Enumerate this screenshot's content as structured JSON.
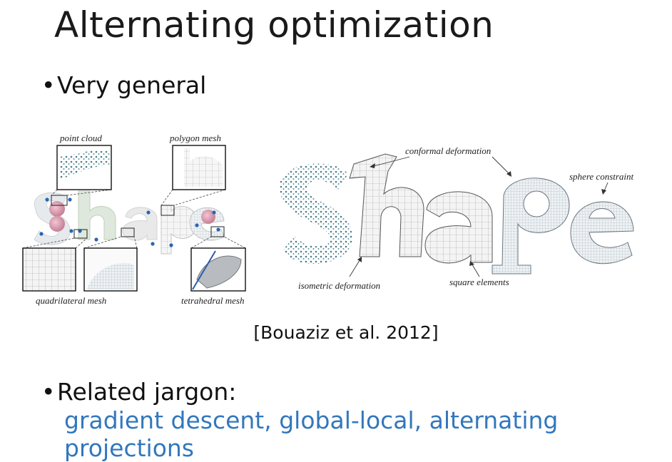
{
  "slide": {
    "title": "Alternating optimization",
    "bullet1": "Very general",
    "citation": "[Bouaziz et al. 2012]",
    "bullet2": "Related jargon:",
    "jargon": "gradient descent, global-local, alternating projections",
    "jargon_color": "#3277bd",
    "bullet_glyph": "•"
  },
  "figure_left": {
    "labels": {
      "point_cloud": "point cloud",
      "polygon_mesh": "polygon mesh",
      "quadrilateral_mesh": "quadrilateral mesh",
      "tetrahedral_mesh": "tetrahedral mesh"
    },
    "word": "Shape"
  },
  "figure_right": {
    "labels": {
      "conformal_deformation": "conformal deformation",
      "sphere_constraint": "sphere constraint",
      "isometric_deformation": "isometric deformation",
      "square_elements": "square elements"
    },
    "word": "Shape"
  }
}
